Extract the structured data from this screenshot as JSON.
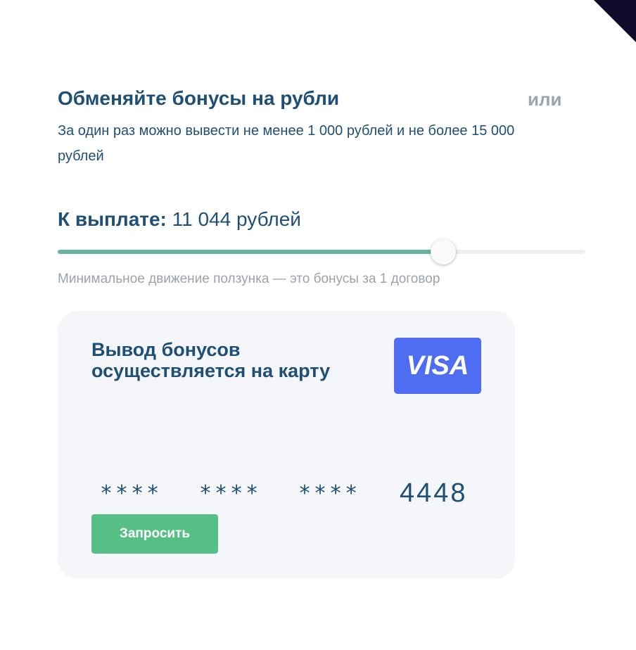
{
  "header": {
    "title": "Обменяйте бонусы на рубли",
    "alt_option": "или"
  },
  "limits_text": "За один раз можно вывести не менее 1 000 рублей и не более 15 000 рублей",
  "payout": {
    "label": "К выплате:",
    "amount": "11 044 рублей"
  },
  "slider": {
    "value_fraction": 0.73,
    "hint": "Минимальное движение ползунка — это бонусы за 1 договор"
  },
  "card": {
    "title": "Вывод бонусов осуществляется на карту",
    "brand": "VISA",
    "masked_groups": [
      "****",
      "****",
      "****"
    ],
    "last_digits": "4448",
    "request_button": "Запросить"
  },
  "colors": {
    "primary_text": "#1f4f74",
    "slider_fill": "#66b3a2",
    "visa_bg": "#4e6df0",
    "button_bg": "#56bf86",
    "card_bg": "#f4f6fa"
  }
}
